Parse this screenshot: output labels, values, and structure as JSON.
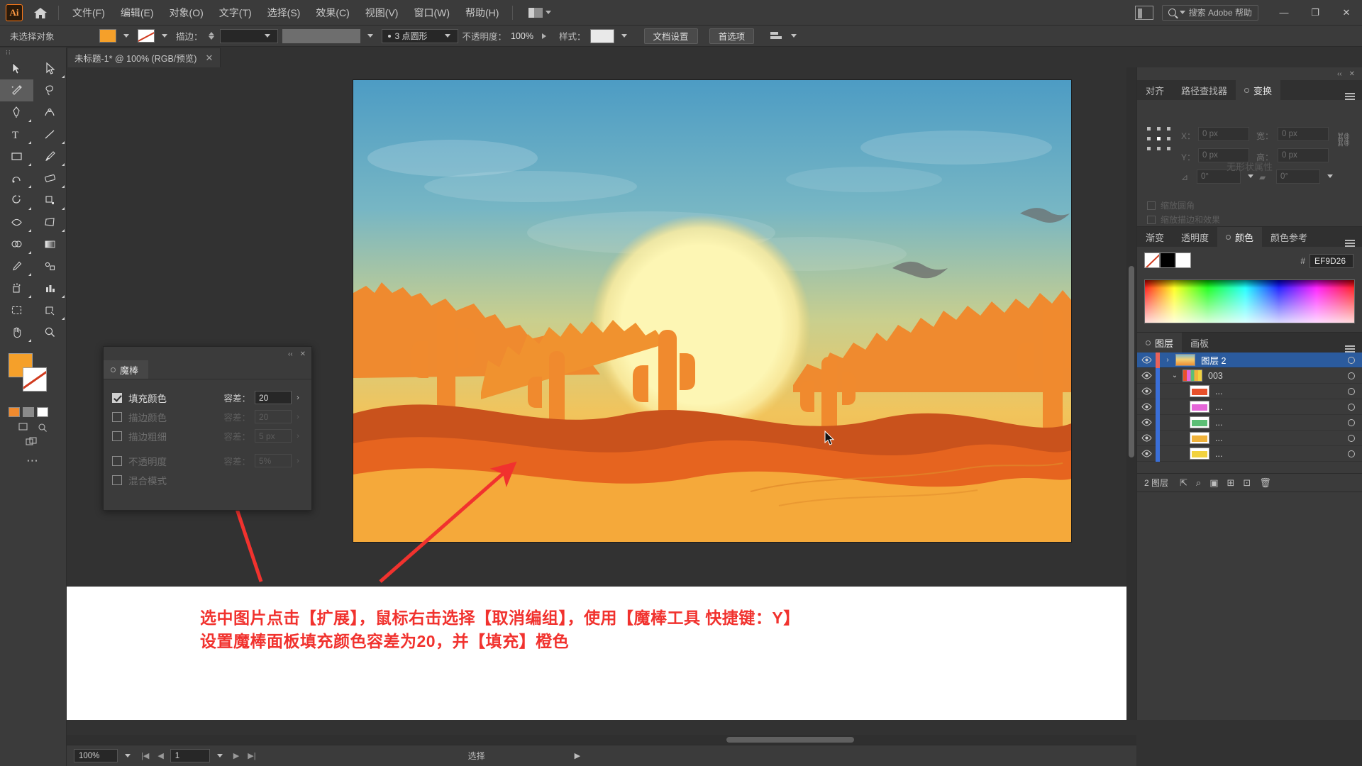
{
  "app": {
    "name": "Adobe Illustrator",
    "logo_text": "Ai"
  },
  "menubar": {
    "items": [
      {
        "label": "文件(F)",
        "name": "menu-file"
      },
      {
        "label": "编辑(E)",
        "name": "menu-edit"
      },
      {
        "label": "对象(O)",
        "name": "menu-object"
      },
      {
        "label": "文字(T)",
        "name": "menu-type"
      },
      {
        "label": "选择(S)",
        "name": "menu-select"
      },
      {
        "label": "效果(C)",
        "name": "menu-effect"
      },
      {
        "label": "视图(V)",
        "name": "menu-view"
      },
      {
        "label": "窗口(W)",
        "name": "menu-window"
      },
      {
        "label": "帮助(H)",
        "name": "menu-help"
      }
    ],
    "search_placeholder": "搜索 Adobe 帮助",
    "window_controls": {
      "minimize": "—",
      "maximize": "❐",
      "close": "✕"
    }
  },
  "controlbar": {
    "selection_status": "未选择对象",
    "fill_color": "#F5A02A",
    "stroke_color": "#FFFFFF",
    "stroke_label": "描边：",
    "stroke_weight": "",
    "stroke_profile": "",
    "brush_label": "3 点圆形",
    "opacity_label": "不透明度：",
    "opacity_value": "100%",
    "style_label": "样式：",
    "doc_setup_button": "文档设置",
    "preferences_button": "首选项"
  },
  "document_tab": {
    "title": "未标题-1* @ 100% (RGB/预览)",
    "close_glyph": "✕"
  },
  "toolbar": {
    "tools": [
      "selection-tool",
      "direct-selection-tool",
      "magic-wand-tool",
      "lasso-tool",
      "pen-tool",
      "curvature-tool",
      "type-tool",
      "line-segment-tool",
      "rectangle-tool",
      "paintbrush-tool",
      "shaper-tool",
      "eraser-tool",
      "rotate-tool",
      "scale-tool",
      "width-tool",
      "free-transform-tool",
      "shape-builder-tool",
      "gradient-tool",
      "eyedropper-tool",
      "blend-tool",
      "symbol-sprayer-tool",
      "column-graph-tool",
      "artboard-tool",
      "slice-tool",
      "hand-tool",
      "zoom-tool"
    ],
    "fill_swatch": "#F5A02A",
    "stroke_swatch": "#FFFFFF",
    "more_glyph": "⋯"
  },
  "magic_wand_panel": {
    "tab_label": "魔棒",
    "close_glyph": "✕",
    "collapse_glyph": "‹‹",
    "rows": [
      {
        "label": "填充颜色",
        "checked": true,
        "tolerance_label": "容差：",
        "tolerance_value": "20",
        "enabled": true
      },
      {
        "label": "描边颜色",
        "checked": false,
        "tolerance_label": "容差：",
        "tolerance_value": "20",
        "enabled": false
      },
      {
        "label": "描边粗细",
        "checked": false,
        "tolerance_label": "容差：",
        "tolerance_value": "5 px",
        "enabled": false
      },
      {
        "label": "不透明度",
        "checked": false,
        "tolerance_label": "容差：",
        "tolerance_value": "5%",
        "enabled": false
      },
      {
        "label": "混合模式",
        "checked": false,
        "tolerance_label": "",
        "tolerance_value": "",
        "enabled": false
      }
    ]
  },
  "transform_panel": {
    "tabs": [
      {
        "label": "对齐",
        "active": false
      },
      {
        "label": "路径查找器",
        "active": false
      },
      {
        "label": "变换",
        "active": true
      }
    ],
    "fields": {
      "x_label": "X：",
      "x_value": "0 px",
      "y_label": "Y：",
      "y_value": "0 px",
      "w_label": "宽：",
      "w_value": "0 px",
      "h_label": "高：",
      "h_value": "0 px",
      "angle_value": "0°",
      "shear_value": "0°"
    },
    "checkboxes": [
      "缩放圆角",
      "缩放描边和效果"
    ],
    "no_properties": "无形状属性"
  },
  "color_panel": {
    "tabs": [
      {
        "label": "渐变",
        "active": false
      },
      {
        "label": "透明度",
        "active": false
      },
      {
        "label": "颜色",
        "active": true
      },
      {
        "label": "颜色参考",
        "active": false
      }
    ],
    "hex_symbol": "#",
    "hex_value": "EF9D26",
    "swatches": [
      "none",
      "#000000",
      "#FFFFFF"
    ]
  },
  "layers_panel": {
    "tabs": [
      {
        "label": "图层",
        "active": true
      },
      {
        "label": "画板",
        "active": false
      }
    ],
    "rows": [
      {
        "name": "图层 2",
        "selected": true,
        "indent": 0,
        "bar": "#E8625A",
        "thumb": "artwork",
        "expander": "›"
      },
      {
        "name": "003",
        "selected": false,
        "indent": 1,
        "bar": "#3A6FD8",
        "thumb": "group",
        "expander": "⌄"
      },
      {
        "name": "...",
        "selected": false,
        "indent": 2,
        "bar": "#3A6FD8",
        "thumb": "#E8502A",
        "expander": ""
      },
      {
        "name": "...",
        "selected": false,
        "indent": 2,
        "bar": "#3A6FD8",
        "thumb": "#E566D8",
        "expander": ""
      },
      {
        "name": "...",
        "selected": false,
        "indent": 2,
        "bar": "#3A6FD8",
        "thumb": "#5CBF75",
        "expander": ""
      },
      {
        "name": "...",
        "selected": false,
        "indent": 2,
        "bar": "#3A6FD8",
        "thumb": "#F0B23A",
        "expander": ""
      },
      {
        "name": "...",
        "selected": false,
        "indent": 2,
        "bar": "#3A6FD8",
        "thumb": "#F2D23E",
        "expander": ""
      }
    ],
    "footer_count": "2 图层",
    "footer_icons": [
      "locate-object-icon",
      "make-clipping-mask-icon",
      "create-new-sublayer-icon",
      "create-new-layer-icon",
      "delete-selection-icon"
    ]
  },
  "statusbar": {
    "zoom_value": "100%",
    "artboard_value": "1",
    "status_text": "选择",
    "first_glyph": "|◀",
    "prev_glyph": "◀",
    "next_glyph": "▶",
    "last_glyph": "▶|",
    "expand_glyph": "▶"
  },
  "annotation": {
    "line1": "选中图片点击【扩展】，鼠标右击选择【取消编组】，使用【魔棒工具 快捷键：Y】",
    "line2": "设置魔棒面板填充颜色容差为20，并【填充】橙色",
    "color": "#F1322E",
    "arrows": 2
  },
  "artwork": {
    "description": "desert-sunset-illustration",
    "sky_top": "#5BA3C6",
    "sun": "#FBF2A8",
    "sand": "#F5A93A",
    "cactus": "#F08A2E",
    "mesa_dark": "#C9521C"
  }
}
